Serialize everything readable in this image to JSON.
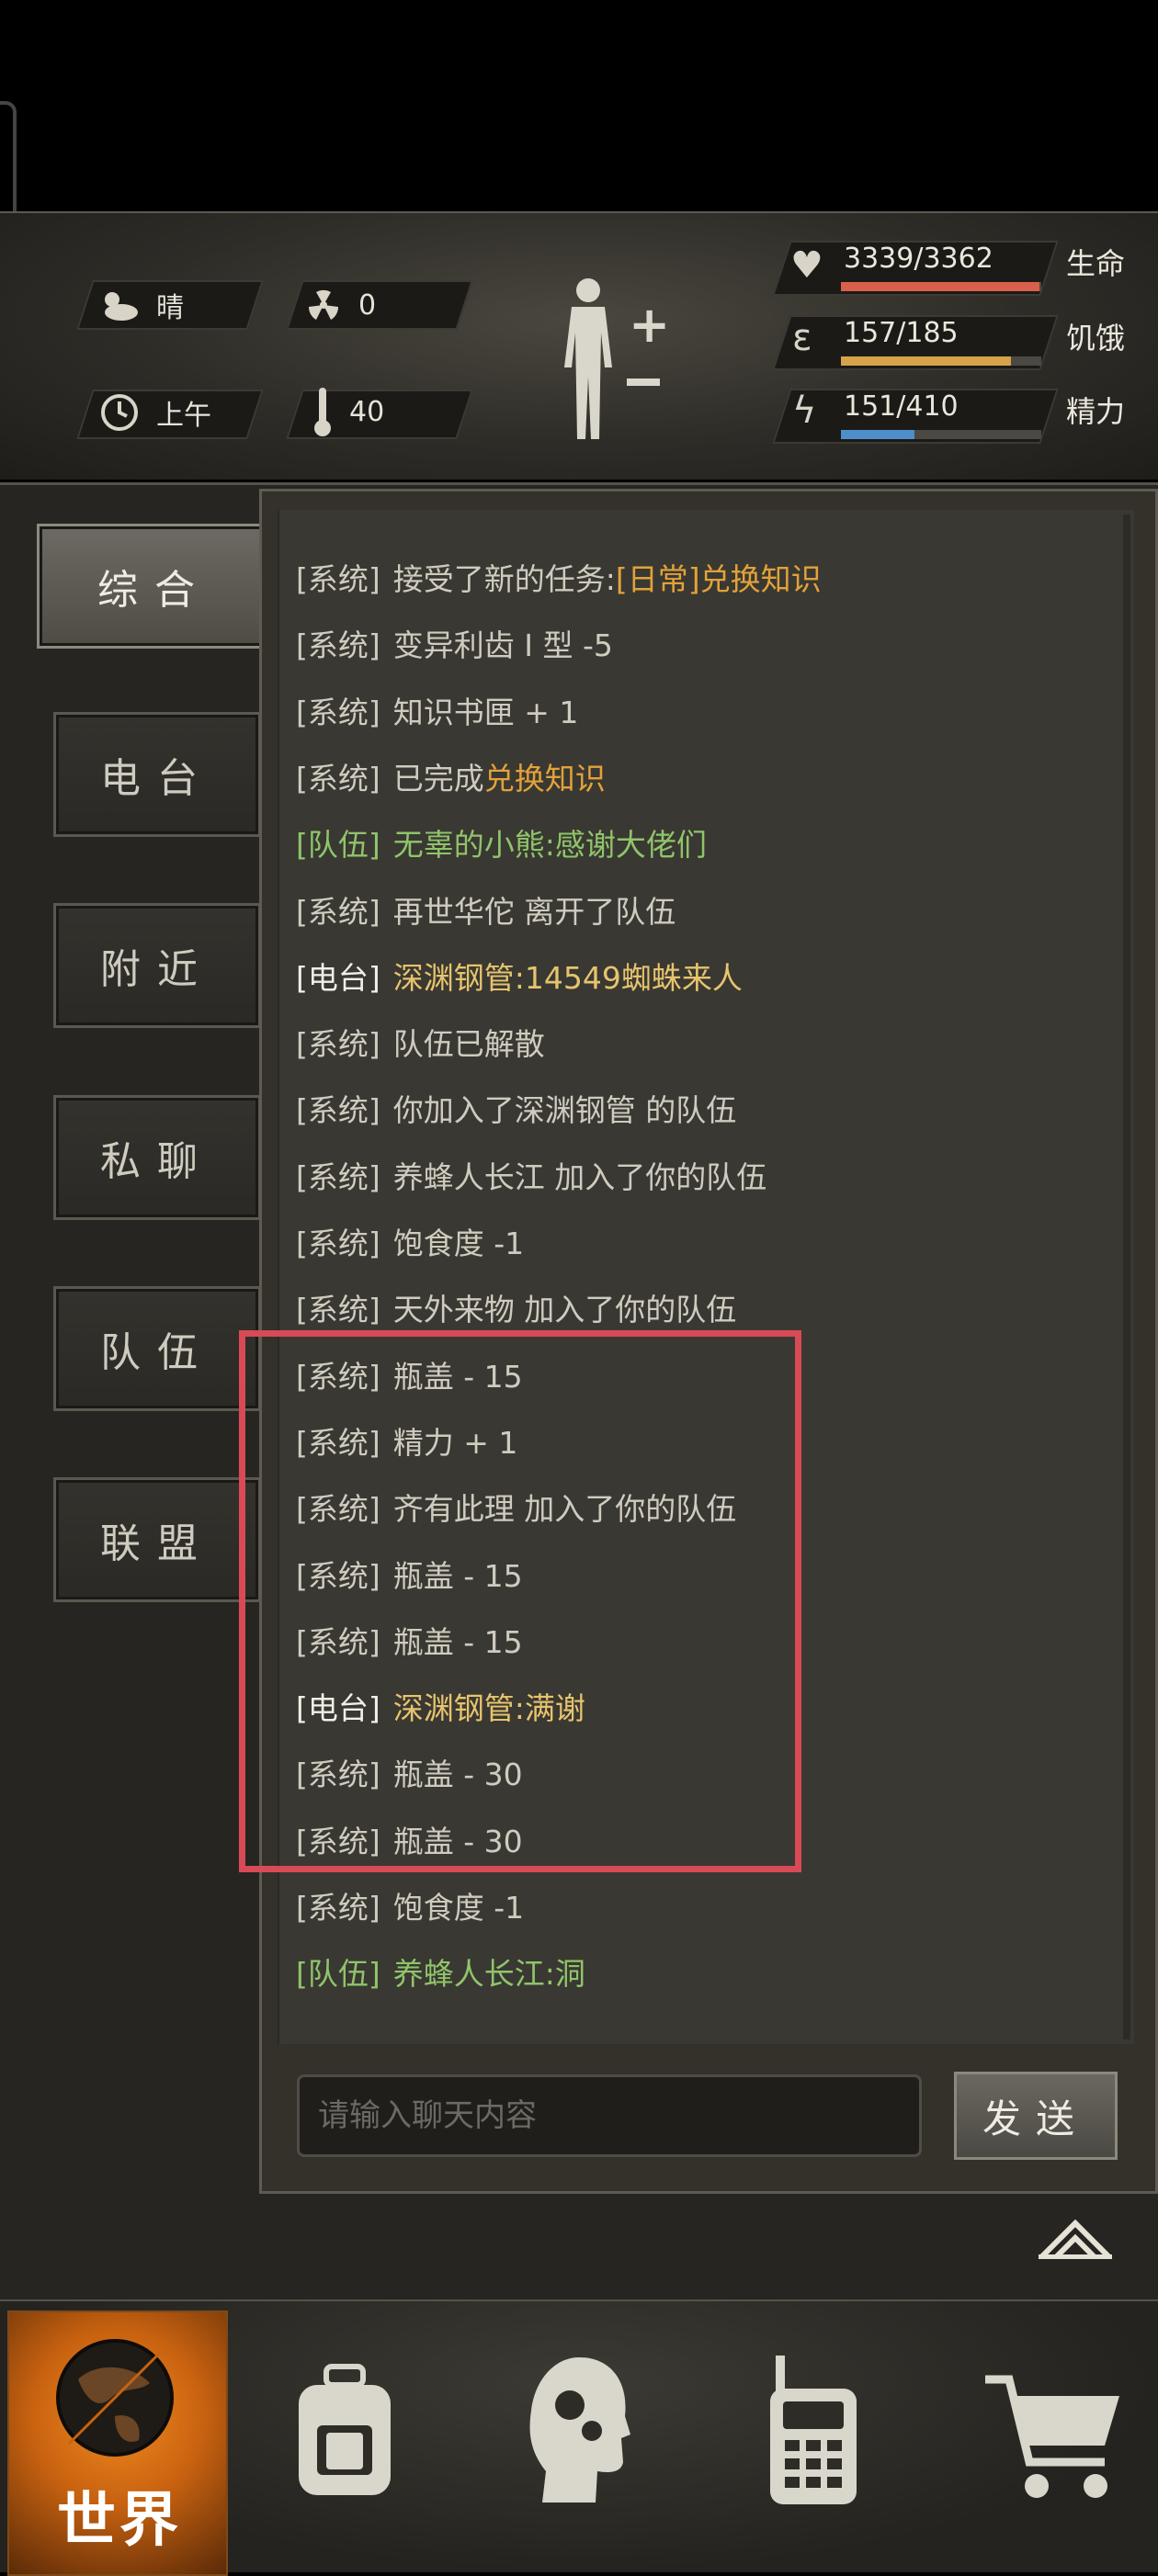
{
  "status": {
    "weather": "晴",
    "radiation": "0",
    "time_of_day": "上午",
    "temperature": "40"
  },
  "stats": {
    "hp": {
      "value": "3339/3362",
      "label": "生命",
      "fraction": 0.993,
      "color": "#d9604a"
    },
    "hunger": {
      "value": "157/185",
      "label": "饥饿",
      "fraction": 0.849,
      "color": "#d6a24a"
    },
    "energy": {
      "value": "151/410",
      "label": "精力",
      "fraction": 0.368,
      "color": "#4f8fc9"
    }
  },
  "tabs": [
    "综合",
    "电台",
    "附近",
    "私聊",
    "队伍",
    "联盟"
  ],
  "active_tab": 0,
  "colors": {
    "system": "#cfcbbf",
    "orange": "#e2a23a",
    "team": "#8fc46b",
    "radio_name": "#e6c46e",
    "highlight": "#d84a55"
  },
  "messages": [
    {
      "ch": "[系统]",
      "parts": [
        {
          "t": "接受了新的任务:",
          "c": "system"
        },
        {
          "t": "[日常]兑换知识",
          "c": "orange"
        }
      ],
      "chc": "system"
    },
    {
      "ch": "[系统]",
      "parts": [
        {
          "t": "变异利齿 I 型 -5",
          "c": "system"
        }
      ],
      "chc": "system"
    },
    {
      "ch": "[系统]",
      "parts": [
        {
          "t": "知识书匣 + 1",
          "c": "system"
        }
      ],
      "chc": "system"
    },
    {
      "ch": "[系统]",
      "parts": [
        {
          "t": "已完成",
          "c": "system"
        },
        {
          "t": "兑换知识",
          "c": "orange"
        }
      ],
      "chc": "system"
    },
    {
      "ch": "[队伍]",
      "parts": [
        {
          "t": "无辜的小熊:感谢大佬们",
          "c": "team"
        }
      ],
      "chc": "team"
    },
    {
      "ch": "[系统]",
      "parts": [
        {
          "t": "再世华佗 离开了队伍",
          "c": "system"
        }
      ],
      "chc": "system"
    },
    {
      "ch": "[电台]",
      "parts": [
        {
          "t": "深渊钢管",
          "c": "radio_name"
        },
        {
          "t": ":14549蜘蛛来人",
          "c": "radio_name"
        }
      ],
      "chc": "white"
    },
    {
      "ch": "[系统]",
      "parts": [
        {
          "t": "队伍已解散",
          "c": "system"
        }
      ],
      "chc": "system"
    },
    {
      "ch": "[系统]",
      "parts": [
        {
          "t": "你加入了深渊钢管 的队伍",
          "c": "system"
        }
      ],
      "chc": "system"
    },
    {
      "ch": "[系统]",
      "parts": [
        {
          "t": "养蜂人长江 加入了你的队伍",
          "c": "system"
        }
      ],
      "chc": "system"
    },
    {
      "ch": "[系统]",
      "parts": [
        {
          "t": "饱食度 -1",
          "c": "system"
        }
      ],
      "chc": "system"
    },
    {
      "ch": "[系统]",
      "parts": [
        {
          "t": "天外来物 加入了你的队伍",
          "c": "system"
        }
      ],
      "chc": "system"
    },
    {
      "ch": "[系统]",
      "parts": [
        {
          "t": "瓶盖 - 15",
          "c": "system"
        }
      ],
      "chc": "system"
    },
    {
      "ch": "[系统]",
      "parts": [
        {
          "t": "精力 + 1",
          "c": "system"
        }
      ],
      "chc": "system"
    },
    {
      "ch": "[系统]",
      "parts": [
        {
          "t": "齐有此理 加入了你的队伍",
          "c": "system"
        }
      ],
      "chc": "system"
    },
    {
      "ch": "[系统]",
      "parts": [
        {
          "t": "瓶盖 - 15",
          "c": "system"
        }
      ],
      "chc": "system"
    },
    {
      "ch": "[系统]",
      "parts": [
        {
          "t": "瓶盖 - 15",
          "c": "system"
        }
      ],
      "chc": "system"
    },
    {
      "ch": "[电台]",
      "parts": [
        {
          "t": "深渊钢管",
          "c": "radio_name"
        },
        {
          "t": ":满谢",
          "c": "radio_name"
        }
      ],
      "chc": "white"
    },
    {
      "ch": "[系统]",
      "parts": [
        {
          "t": "瓶盖 - 30",
          "c": "system"
        }
      ],
      "chc": "system"
    },
    {
      "ch": "[系统]",
      "parts": [
        {
          "t": "瓶盖 - 30",
          "c": "system"
        }
      ],
      "chc": "system"
    },
    {
      "ch": "[系统]",
      "parts": [
        {
          "t": "饱食度 -1",
          "c": "system"
        }
      ],
      "chc": "system"
    },
    {
      "ch": "[队伍]",
      "parts": [
        {
          "t": "养蜂人长江:洞",
          "c": "team"
        }
      ],
      "chc": "team"
    }
  ],
  "input": {
    "placeholder": "请输入聊天内容"
  },
  "send_label": "发送",
  "nav": {
    "world_label": "世界"
  }
}
